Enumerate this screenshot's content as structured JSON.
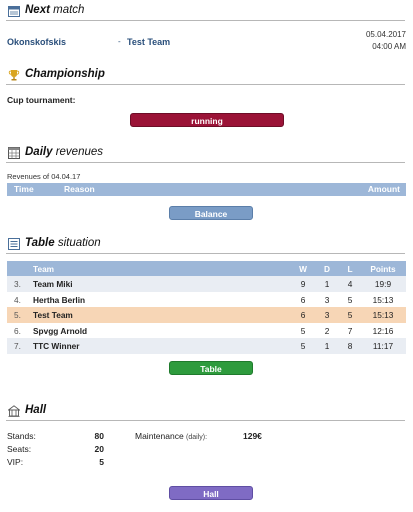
{
  "next_match": {
    "title_bold": "Next",
    "title_rest": "match",
    "home_team": "Okonskofskis",
    "separator": "-",
    "away_team": "Test Team",
    "date": "05.04.2017",
    "time": "04:00 AM"
  },
  "championship": {
    "title_bold": "Championship",
    "label": "Cup tournament:",
    "status_button": "running"
  },
  "daily_revenues": {
    "title_bold": "Daily",
    "title_rest": "revenues",
    "subtitle": "Revenues of 04.04.17",
    "columns": {
      "time": "Time",
      "reason": "Reason",
      "amount": "Amount"
    },
    "balance_button": "Balance"
  },
  "table_situation": {
    "title_bold": "Table",
    "title_rest": "situation",
    "columns": {
      "team": "Team",
      "w": "W",
      "d": "D",
      "l": "L",
      "points": "Points"
    },
    "rows": [
      {
        "pos": "3.",
        "team": "Team Miki",
        "w": "9",
        "d": "1",
        "l": "4",
        "points": "19:9"
      },
      {
        "pos": "4.",
        "team": "Hertha Berlin",
        "w": "6",
        "d": "3",
        "l": "5",
        "points": "15:13"
      },
      {
        "pos": "5.",
        "team": "Test Team",
        "w": "6",
        "d": "3",
        "l": "5",
        "points": "15:13"
      },
      {
        "pos": "6.",
        "team": "Spvgg Arnold",
        "w": "5",
        "d": "2",
        "l": "7",
        "points": "12:16"
      },
      {
        "pos": "7.",
        "team": "TTC Winner",
        "w": "5",
        "d": "1",
        "l": "8",
        "points": "11:17"
      }
    ],
    "table_button": "Table"
  },
  "hall": {
    "title_bold": "Hall",
    "stands_label": "Stands:",
    "stands_value": "80",
    "seats_label": "Seats:",
    "seats_value": "20",
    "vip_label": "VIP:",
    "vip_value": "5",
    "maintenance_label": "Maintenance",
    "maintenance_note": "(daily):",
    "maintenance_value": "129€",
    "hall_button": "Hall"
  },
  "colors": {
    "running": "#9b1337",
    "balance": "#7a9cc6",
    "table": "#2e9b3d",
    "hall": "#7f6bc4",
    "table_header": "#9db7d8",
    "highlight_row": "#f7d6b6"
  },
  "icons": {
    "next_match": "calendar-icon",
    "championship": "trophy-icon",
    "daily_revenues": "ledger-icon",
    "table_situation": "table-icon",
    "hall": "stadium-icon"
  }
}
